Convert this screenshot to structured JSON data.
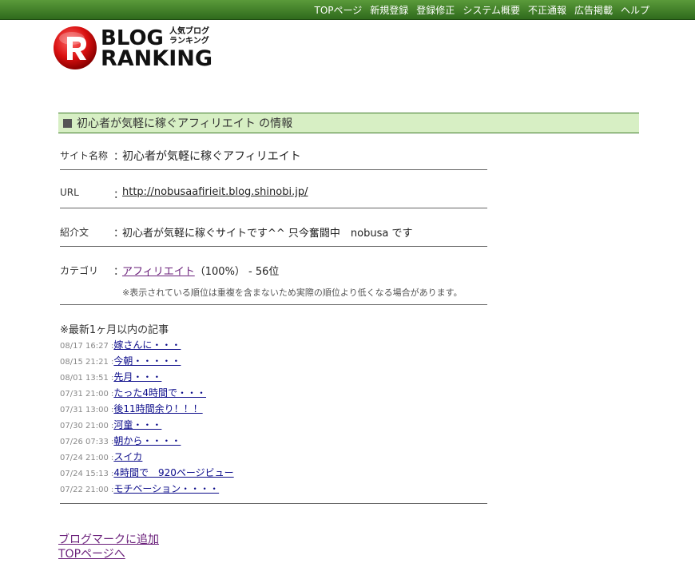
{
  "nav": {
    "items": [
      "TOPページ",
      "新規登録",
      "登録修正",
      "システム概要",
      "不正通報",
      "広告掲載",
      "ヘルプ"
    ]
  },
  "logo": {
    "line1": "BLOG",
    "line2": "RANKING",
    "sub1": "人気ブログ",
    "sub2": "ランキング"
  },
  "section": {
    "title": "初心者が気軽に稼ぐアフィリエイト の情報"
  },
  "info": {
    "site_label": "サイト名称",
    "site_value": "初心者が気軽に稼ぐアフィリエイト",
    "url_label": "URL",
    "url_value": "http://nobusaafirieit.blog.shinobi.jp/",
    "intro_label": "紹介文",
    "intro_value": "初心者が気軽に稼ぐサイトです^^ 只今奮闘中　nobusa です",
    "category_label": "カテゴリ",
    "category_link": "アフィリエイト",
    "category_rest": "（100%） - 56位",
    "category_note": "※表示されている順位は重複を含まないため実際の順位より低くなる場合があります。",
    "colon": "："
  },
  "recent": {
    "title": "※最新1ヶ月以内の記事",
    "articles": [
      {
        "time": "08/17 16:27 :",
        "title": "嫁さんに・・・"
      },
      {
        "time": "08/15 21:21 :",
        "title": "今朝・・・・・"
      },
      {
        "time": "08/01 13:51 :",
        "title": "先月・・・"
      },
      {
        "time": "07/31 21:00 :",
        "title": "たった4時間で・・・"
      },
      {
        "time": "07/31 13:00 :",
        "title": "後11時間余り！！！"
      },
      {
        "time": "07/30 21:00 :",
        "title": "河童・・・"
      },
      {
        "time": "07/26 07:33 :",
        "title": "朝から・・・・"
      },
      {
        "time": "07/24 21:00 :",
        "title": "スイカ"
      },
      {
        "time": "07/24 15:13 :",
        "title": "4時間で　920ページビュー"
      },
      {
        "time": "07/22 21:00 :",
        "title": "モチベーション・・・・"
      }
    ]
  },
  "footer": {
    "bookmark": "ブログマークに追加",
    "top": "TOPページへ"
  }
}
